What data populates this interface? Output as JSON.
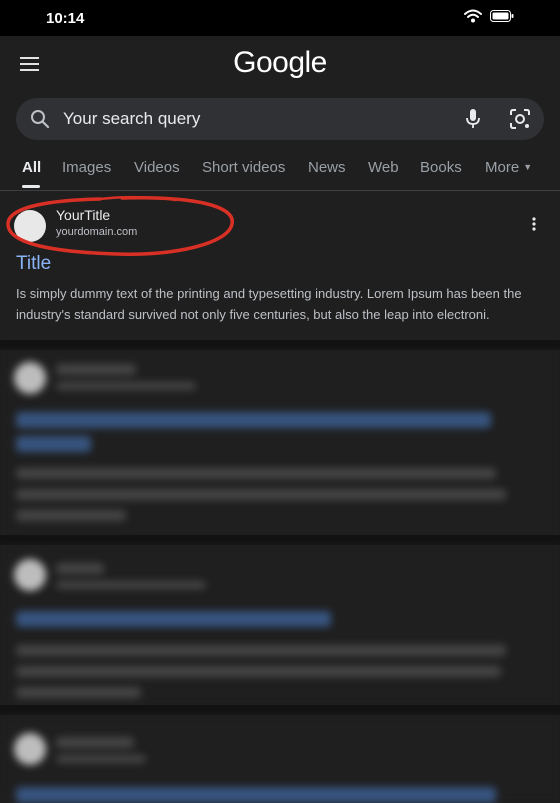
{
  "status": {
    "time": "10:14"
  },
  "header": {
    "logo": "Google"
  },
  "search": {
    "query": "Your search query"
  },
  "tabs": [
    {
      "label": "All",
      "active": true
    },
    {
      "label": "Images"
    },
    {
      "label": "Videos"
    },
    {
      "label": "Short videos"
    },
    {
      "label": "News"
    },
    {
      "label": "Web"
    },
    {
      "label": "Books"
    },
    {
      "label": "More"
    }
  ],
  "result": {
    "site_name": "YourTitle",
    "site_url": "yourdomain.com",
    "title": "Title",
    "snippet": "Is simply dummy text of the printing and typesetting industry. Lorem Ipsum has been the industry's standard survived not only five centuries, but also the leap into electroni."
  },
  "colors": {
    "background": "#1f1f1f",
    "link": "#8ab4f8",
    "highlight": "#d93025",
    "search_bar": "#303134"
  }
}
